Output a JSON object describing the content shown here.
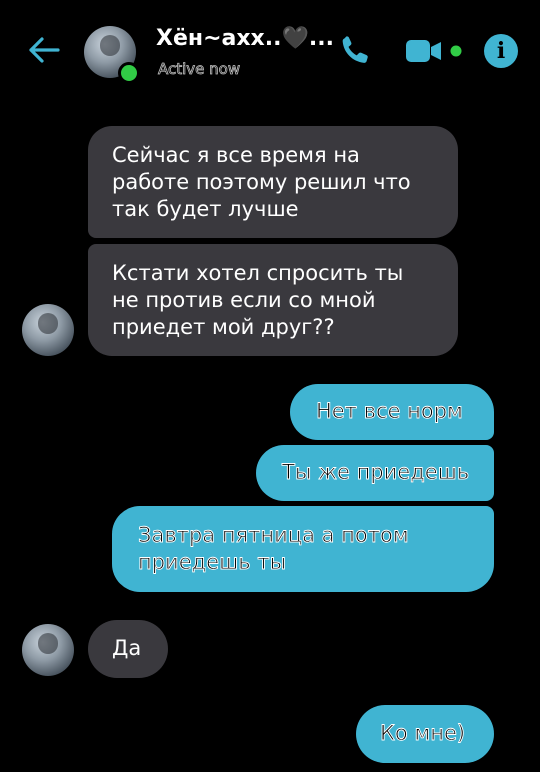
{
  "header": {
    "contact_name": "Хён~ахх..🖤...",
    "status": "Active now",
    "icons": {
      "back": "arrow-left-icon",
      "call": "phone-icon",
      "video": "video-camera-icon",
      "info": "info-icon"
    },
    "info_glyph": "i"
  },
  "colors": {
    "accent": "#40b4d2",
    "incoming_bubble": "#3a393e",
    "online": "#31cc46",
    "background": "#000000"
  },
  "messages": [
    {
      "direction": "incoming",
      "text": "Сейчас я все время на работе поэтому решил что так будет лучше"
    },
    {
      "direction": "incoming",
      "text": "Кстати хотел спросить ты не против если со мной приедет мой друг??"
    },
    {
      "direction": "outgoing",
      "text": "Нет все норм"
    },
    {
      "direction": "outgoing",
      "text": "Ты же приедешь"
    },
    {
      "direction": "outgoing",
      "text": "Завтра пятница а потом приедешь ты"
    },
    {
      "direction": "incoming",
      "text": "Да"
    },
    {
      "direction": "outgoing",
      "text": "Ко мне)"
    }
  ]
}
